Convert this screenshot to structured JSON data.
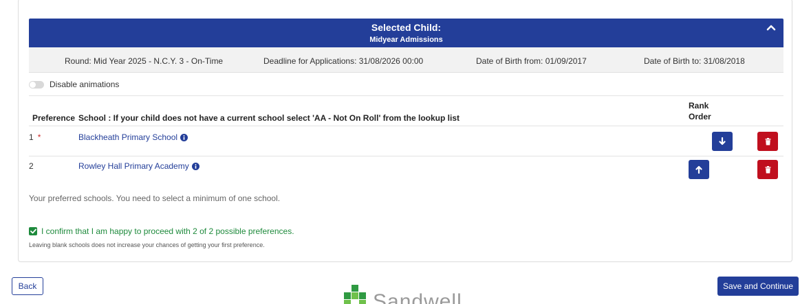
{
  "selected_child": {
    "title": "Selected Child:",
    "subtitle": "Midyear Admissions",
    "collapse_icon": "chevron-up-icon"
  },
  "info": {
    "round": "Round: Mid Year 2025 - N.C.Y. 3 - On-Time",
    "deadline": "Deadline for Applications: 31/08/2026 00:00",
    "dob_from": "Date of Birth from: 01/09/2017",
    "dob_to": "Date of Birth to: 31/08/2018"
  },
  "animations": {
    "label": "Disable animations",
    "enabled": false
  },
  "table": {
    "headers": {
      "preference": "Preference",
      "school": "School : If your child does not have a current school select 'AA - Not On Roll' from the lookup list",
      "rank_line1": "Rank",
      "rank_line2": "Order"
    },
    "rows": [
      {
        "preference": "1",
        "required_mark": "*",
        "school": "Blackheath Primary School",
        "rank_action": "move-down",
        "delete": true
      },
      {
        "preference": "2",
        "required_mark": "",
        "school": "Rowley Hall Primary Academy",
        "rank_action": "move-up",
        "delete": true
      }
    ]
  },
  "help_text": "Your preferred schools. You need to select a minimum of one school.",
  "confirm": {
    "checked": true,
    "text": "I confirm that I am happy to proceed with 2 of 2 possible preferences.",
    "note": "Leaving blank schools does not increase your chances of getting your first preference."
  },
  "footer": {
    "back_label": "Back",
    "save_label": "Save and Continue",
    "logo_text": "Sandwell"
  },
  "colors": {
    "primary": "#233e99",
    "danger": "#c00f1e",
    "success": "#1e8a3c"
  }
}
